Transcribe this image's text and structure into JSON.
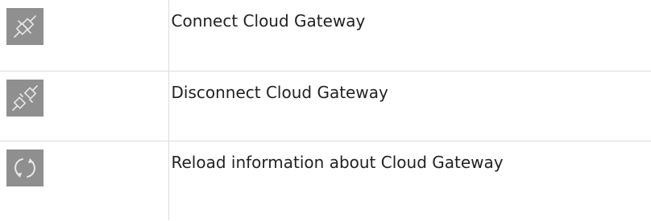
{
  "table": {
    "rows": [
      {
        "icon": "plug-connect-icon",
        "description": "Connect Cloud Gateway"
      },
      {
        "icon": "plug-disconnect-icon",
        "description": "Disconnect Cloud Gateway"
      },
      {
        "icon": "reload-icon",
        "description": "Reload information about Cloud Gateway"
      }
    ]
  },
  "colors": {
    "icon_background": "#8f8f8f",
    "icon_glyph": "#e8e8e8",
    "border": "#dcdcdc",
    "text": "#222222"
  }
}
